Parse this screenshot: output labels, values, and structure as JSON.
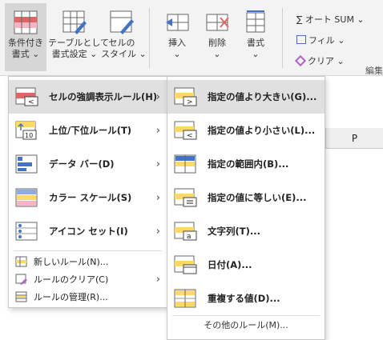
{
  "ribbon": {
    "cond_format": {
      "line1": "条件付き",
      "line2": "書式 ⌄"
    },
    "format_as_table": {
      "line1": "テーブルとして",
      "line2": "書式設定 ⌄"
    },
    "cell_styles": {
      "line1": "セルの",
      "line2": "スタイル ⌄"
    },
    "insert": {
      "line1": "挿入",
      "line2": "⌄"
    },
    "delete": {
      "line1": "削除",
      "line2": "⌄"
    },
    "format": {
      "line1": "書式",
      "line2": "⌄"
    },
    "autosum": "∑ オート SUM ⌄",
    "fill": "フィル ⌄",
    "clear": "クリア ⌄",
    "group_label": "編集"
  },
  "sheet": {
    "column_p": "P"
  },
  "menu": {
    "items": [
      {
        "label": "セルの強調表示ルール(H)",
        "icon": "highlight-rules-icon"
      },
      {
        "label": "上位/下位ルール(T)",
        "icon": "top-bottom-icon"
      },
      {
        "label": "データ バー(D)",
        "icon": "data-bar-icon"
      },
      {
        "label": "カラー スケール(S)",
        "icon": "color-scale-icon"
      },
      {
        "label": "アイコン セット(I)",
        "icon": "icon-set-icon"
      }
    ],
    "small_items": [
      {
        "label": "新しいルール(N)...",
        "icon": "new-rule-icon"
      },
      {
        "label": "ルールのクリア(C)",
        "icon": "clear-rules-icon"
      },
      {
        "label": "ルールの管理(R)...",
        "icon": "manage-rules-icon"
      }
    ],
    "chevron": "›"
  },
  "submenu": {
    "items": [
      {
        "label": "指定の値より大きい(G)...",
        "icon": "greater-than-icon"
      },
      {
        "label": "指定の値より小さい(L)...",
        "icon": "less-than-icon"
      },
      {
        "label": "指定の範囲内(B)...",
        "icon": "between-icon"
      },
      {
        "label": "指定の値に等しい(E)...",
        "icon": "equal-to-icon"
      },
      {
        "label": "文字列(T)...",
        "icon": "text-contains-icon"
      },
      {
        "label": "日付(A)...",
        "icon": "date-occurring-icon"
      },
      {
        "label": "重複する値(D)...",
        "icon": "duplicate-values-icon"
      }
    ],
    "more": "その他のルール(M)..."
  },
  "colors": {
    "accent": "#4472c4",
    "highlight_fill": "#ffd966",
    "red": "#e06666",
    "menu_hover": "#e0e0e0"
  }
}
